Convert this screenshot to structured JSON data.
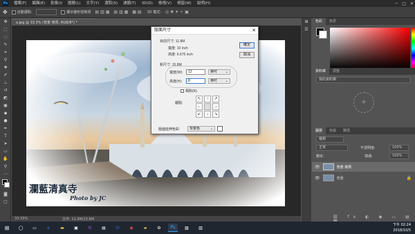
{
  "app": {
    "logo": "Ps"
  },
  "menubar": {
    "items": [
      "檔案(F)",
      "編輯(E)",
      "影像(I)",
      "圖層(L)",
      "文字(Y)",
      "選取(S)",
      "濾鏡(T)",
      "3D(D)",
      "檢視(V)",
      "視窗(W)",
      "說明(H)"
    ]
  },
  "options": {
    "auto_select": "自動選取:",
    "transform": "顯示變形控制項",
    "mode3d": "3D 模式:"
  },
  "document": {
    "tab": "a.jpg @ 33.3% (背景 拷貝, RGB/8*) *",
    "zoom": "33.33%",
    "doc_info": "文件: 11.9M/23.8M"
  },
  "dialog": {
    "title": "版面尺寸",
    "current_size_label": "目前尺寸: 11.8M",
    "current_width": "寬度: 10 inch",
    "current_height": "高度: 6.675 inch",
    "new_size_label": "新尺寸: 15.8M",
    "width_label": "寬度(W):",
    "width_value": "12",
    "width_unit": "英吋",
    "height_label": "高度(H):",
    "height_value": "8",
    "height_unit": "英吋",
    "relative": "相對(R)",
    "anchor_label": "錨點:",
    "ok": "確定",
    "cancel": "取消",
    "ext_color_label": "版面延伸色彩:",
    "ext_color_value": "背景色",
    "anchor_arrows": [
      "↖",
      "↑",
      "↗",
      "←",
      "",
      "→",
      "↙",
      "↓",
      "↘"
    ]
  },
  "canvas_text": {
    "title": "瀾藍清真寺",
    "credit": "Photo by JC"
  },
  "right_panel": {
    "color_tabs": [
      "色彩",
      "色票"
    ],
    "lib_tabs": [
      "資料庫",
      "調整"
    ],
    "lib_select": "我的資料庫",
    "layer_tabs": [
      "圖層",
      "色版",
      "路徑"
    ],
    "kind": "種類",
    "blend": "正常",
    "opacity_label": "不透明度:",
    "opacity": "100%",
    "lock_label": "鎖定:",
    "fill_label": "填滿:",
    "fill": "100%",
    "layers": [
      {
        "name": "背景 拷貝",
        "selected": true
      },
      {
        "name": "背景",
        "selected": false
      }
    ]
  },
  "taskbar": {
    "time": "下午 02:24",
    "date": "2018/10/5"
  },
  "colors": {
    "highlight": "#c8c8c8"
  }
}
